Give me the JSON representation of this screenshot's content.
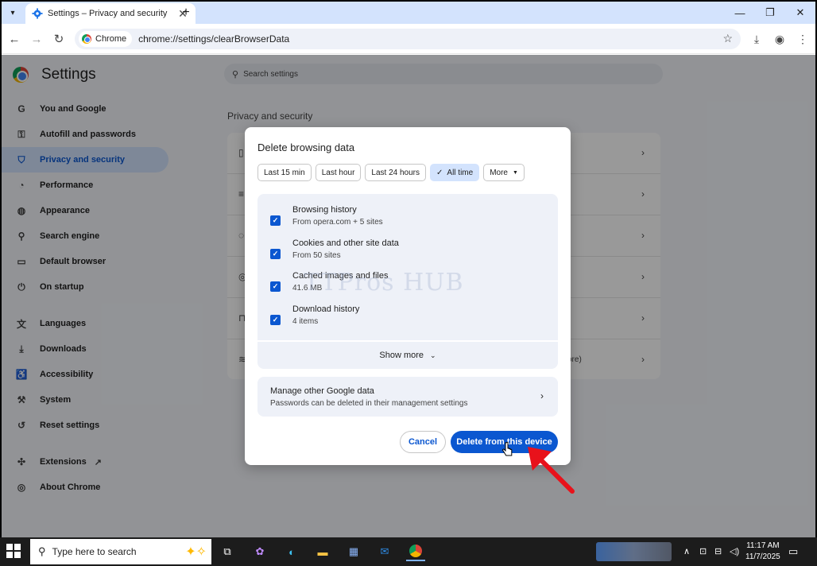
{
  "window": {
    "tab_title": "Settings – Privacy and security",
    "tab_close": "✕",
    "new_tab": "+",
    "minimize": "—",
    "restore": "❐",
    "close": "✕"
  },
  "toolbar": {
    "chip_label": "Chrome",
    "url": "chrome://settings/clearBrowserData"
  },
  "settings": {
    "title": "Settings",
    "search_placeholder": "Search settings",
    "section_title": "Privacy and security",
    "nav": [
      {
        "label": "You and Google",
        "icon": "google-g-icon"
      },
      {
        "label": "Autofill and passwords",
        "icon": "key-icon"
      },
      {
        "label": "Privacy and security",
        "icon": "shield-icon"
      },
      {
        "label": "Performance",
        "icon": "speedometer-icon"
      },
      {
        "label": "Appearance",
        "icon": "palette-icon"
      },
      {
        "label": "Search engine",
        "icon": "search-icon"
      },
      {
        "label": "Default browser",
        "icon": "browser-window-icon"
      },
      {
        "label": "On startup",
        "icon": "power-icon"
      },
      {
        "label": "Languages",
        "icon": "translate-icon"
      },
      {
        "label": "Downloads",
        "icon": "download-icon"
      },
      {
        "label": "Accessibility",
        "icon": "accessibility-icon"
      },
      {
        "label": "System",
        "icon": "wrench-icon"
      },
      {
        "label": "Reset settings",
        "icon": "reset-icon"
      },
      {
        "label": "Extensions",
        "icon": "puzzle-icon"
      },
      {
        "label": "About Chrome",
        "icon": "chrome-icon"
      }
    ],
    "card_more_text": "ore)"
  },
  "dialog": {
    "title": "Delete browsing data",
    "ranges": [
      {
        "label": "Last 15 min",
        "selected": false
      },
      {
        "label": "Last hour",
        "selected": false
      },
      {
        "label": "Last 24 hours",
        "selected": false
      },
      {
        "label": "All time",
        "selected": true
      },
      {
        "label": "More",
        "selected": false
      }
    ],
    "items": [
      {
        "title": "Browsing history",
        "subtitle": "From opera.com + 5 sites",
        "checked": true
      },
      {
        "title": "Cookies and other site data",
        "subtitle": "From 50 sites",
        "checked": true
      },
      {
        "title": "Cached images and files",
        "subtitle": "41.6 MB",
        "checked": true
      },
      {
        "title": "Download history",
        "subtitle": "4 items",
        "checked": true
      }
    ],
    "show_more": "Show more",
    "manage_title": "Manage other Google data",
    "manage_subtitle": "Passwords can be deleted in their management settings",
    "cancel_label": "Cancel",
    "delete_label": "Delete from this device",
    "watermark": "TTPros HUB"
  },
  "taskbar": {
    "search_placeholder": "Type here to search",
    "time": "11:17 AM",
    "date": "11/7/2025"
  },
  "colors": {
    "accent": "#0b57d0",
    "selected_chip": "#d3e3fd",
    "arrow": "#e8121b"
  }
}
